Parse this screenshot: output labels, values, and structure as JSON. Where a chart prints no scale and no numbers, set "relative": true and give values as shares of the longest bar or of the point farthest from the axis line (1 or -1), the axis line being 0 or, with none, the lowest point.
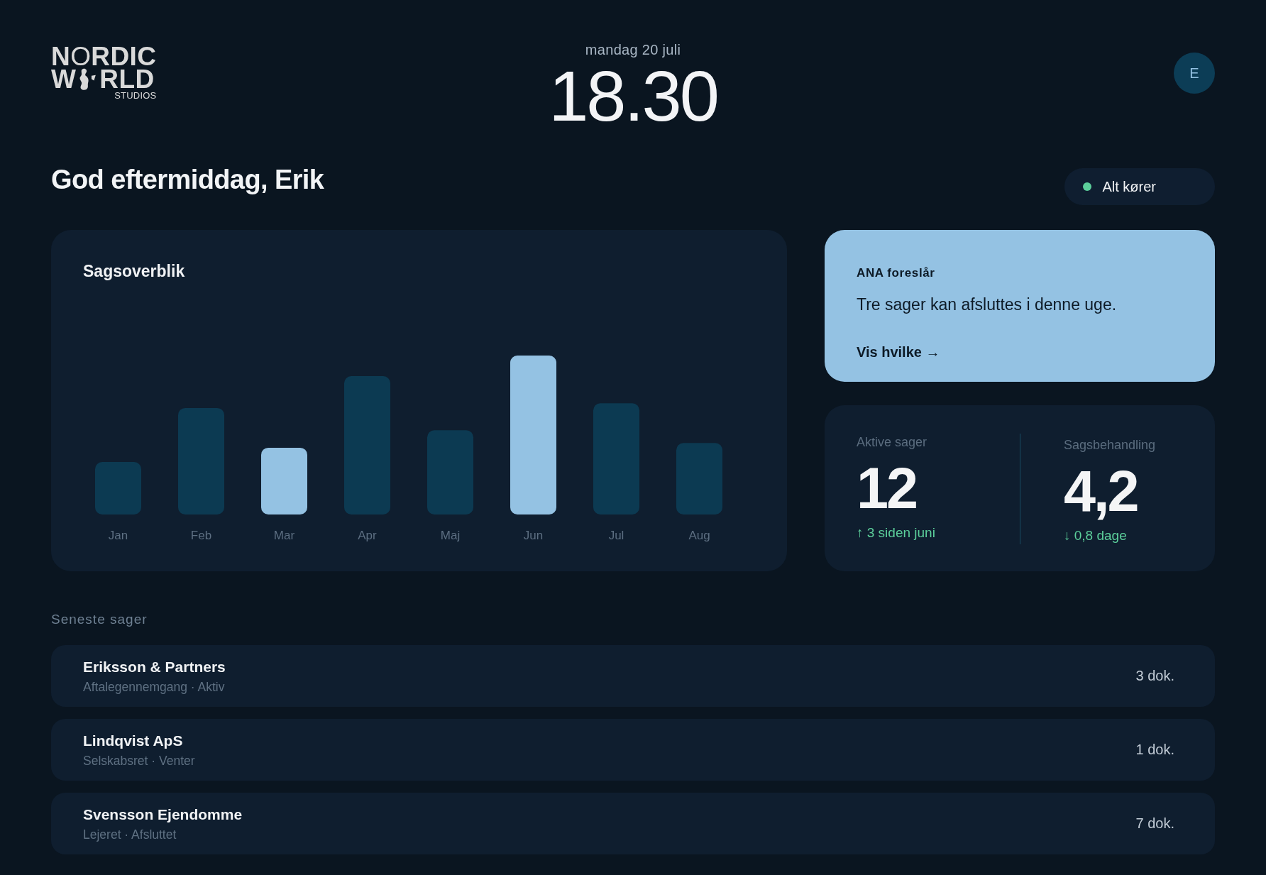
{
  "header": {
    "logo": {
      "line_1": "NORDIC",
      "line_2_parts": [
        "W",
        "RLD"
      ],
      "tagline": "STUDIOS"
    },
    "date": "mandag 20 juli",
    "time": "18.30",
    "avatar": {
      "initial": "E"
    }
  },
  "greeting": "God eftermiddag, Erik",
  "status": {
    "label": "Alt kører",
    "healthy": true
  },
  "overview": {
    "chart_data": {
      "type": "bar",
      "title": "Sagsoverblik",
      "relative": true,
      "categories": [
        "Jan",
        "Feb",
        "Mar",
        "Apr",
        "Maj",
        "Jun",
        "Jul",
        "Aug"
      ],
      "values": [
        0.33,
        0.67,
        0.42,
        0.87,
        0.53,
        1,
        0.7,
        0.45
      ]
    },
    "highlighted": [
      false,
      false,
      true,
      false,
      false,
      true,
      false,
      false
    ]
  },
  "suggestion": {
    "label": "ANA foreslår",
    "text": "Tre sager kan afsluttes i denne uge.",
    "link": "Vis hvilke →"
  },
  "stats": [
    {
      "label": "Aktive sager",
      "value": "12",
      "change": "↑ 3 siden juni"
    },
    {
      "label": "Sagsbehandling",
      "value": "4,2",
      "change": "↓ 0,8 dage"
    }
  ],
  "recent": {
    "title": "Seneste sager",
    "rows": [
      {
        "name": "Eriksson & Partners",
        "detail": "Aftalegennemgang · Aktiv",
        "count": "3 dok."
      },
      {
        "name": "Lindqvist ApS",
        "detail": "Selskabsret · Venter",
        "count": "1 dok."
      },
      {
        "name": "Svensson Ejendomme",
        "detail": "Lejeret · Afsluttet",
        "count": "7 dok."
      }
    ]
  }
}
